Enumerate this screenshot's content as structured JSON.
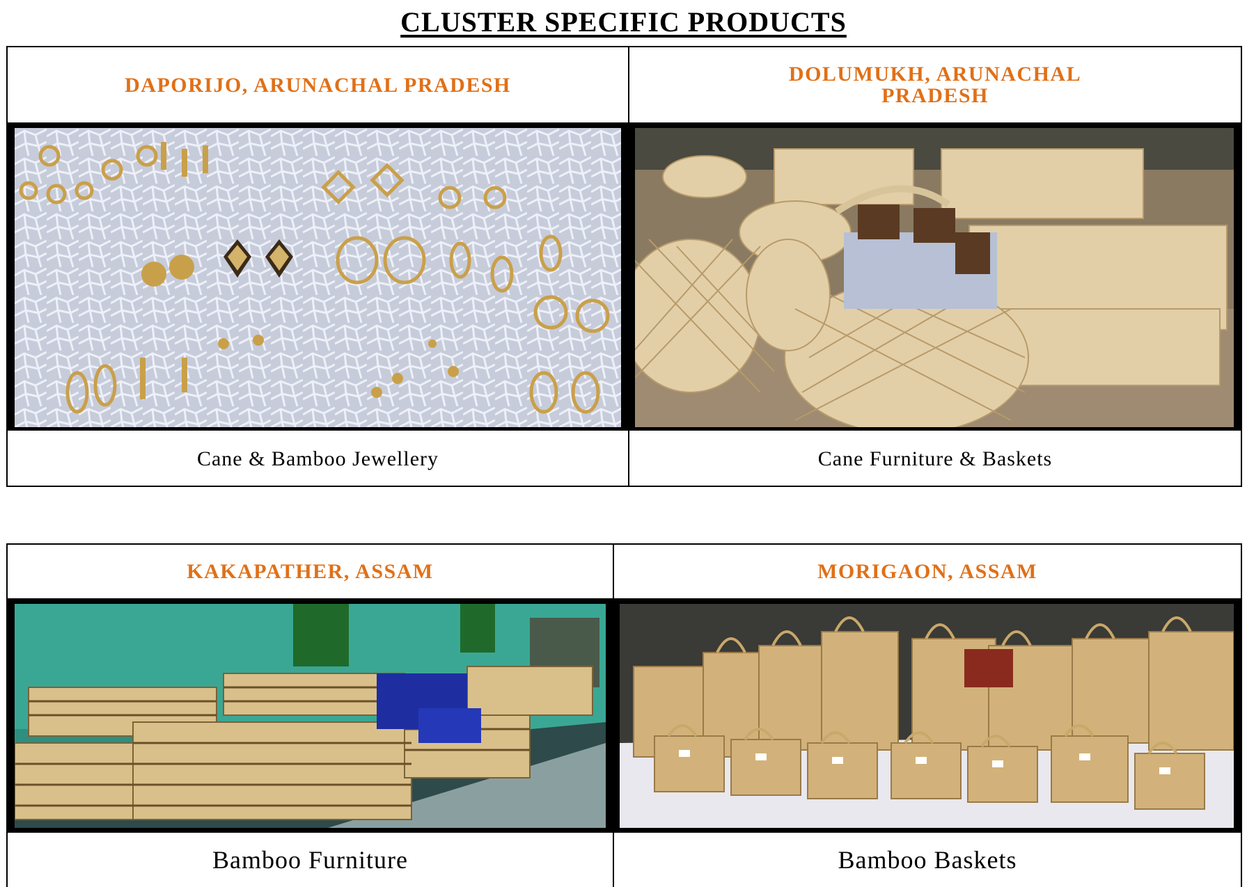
{
  "title": "CLUSTER SPECIFIC PRODUCTS",
  "clusters": [
    {
      "location": "DAPORIJO, ARUNACHAL PRADESH",
      "caption": "Cane & Bamboo Jewellery"
    },
    {
      "location": "DOLUMUKH, ARUNACHAL PRADESH",
      "caption": "Cane Furniture & Baskets"
    },
    {
      "location": "KAKAPATHER, ASSAM",
      "caption": "Bamboo Furniture"
    },
    {
      "location": "MORIGAON, ASSAM",
      "caption": "Bamboo Baskets"
    }
  ],
  "colors": {
    "location_heading": "#e07018",
    "border": "#000000"
  }
}
